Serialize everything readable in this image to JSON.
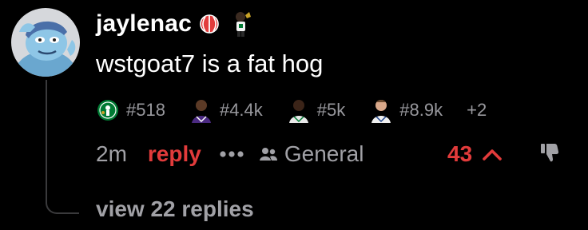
{
  "comment": {
    "username": "jaylenac",
    "text": "wstgoat7 is a fat hog",
    "timestamp": "2m",
    "reply_label": "reply",
    "channel": "General",
    "vote_count": "43",
    "view_replies_label": "view 22 replies"
  },
  "flairs": [
    {
      "icon": "celtics-logo-icon",
      "rank": "#518"
    },
    {
      "icon": "player-headshot-icon",
      "rank": "#4.4k"
    },
    {
      "icon": "player-headshot-icon",
      "rank": "#5k"
    },
    {
      "icon": "player-headshot-icon",
      "rank": "#8.9k"
    }
  ],
  "flair_more": "+2",
  "colors": {
    "background": "#000000",
    "accent_red": "#e23b3b",
    "muted_text": "#a1a1a6",
    "celtics_green": "#007a33"
  }
}
